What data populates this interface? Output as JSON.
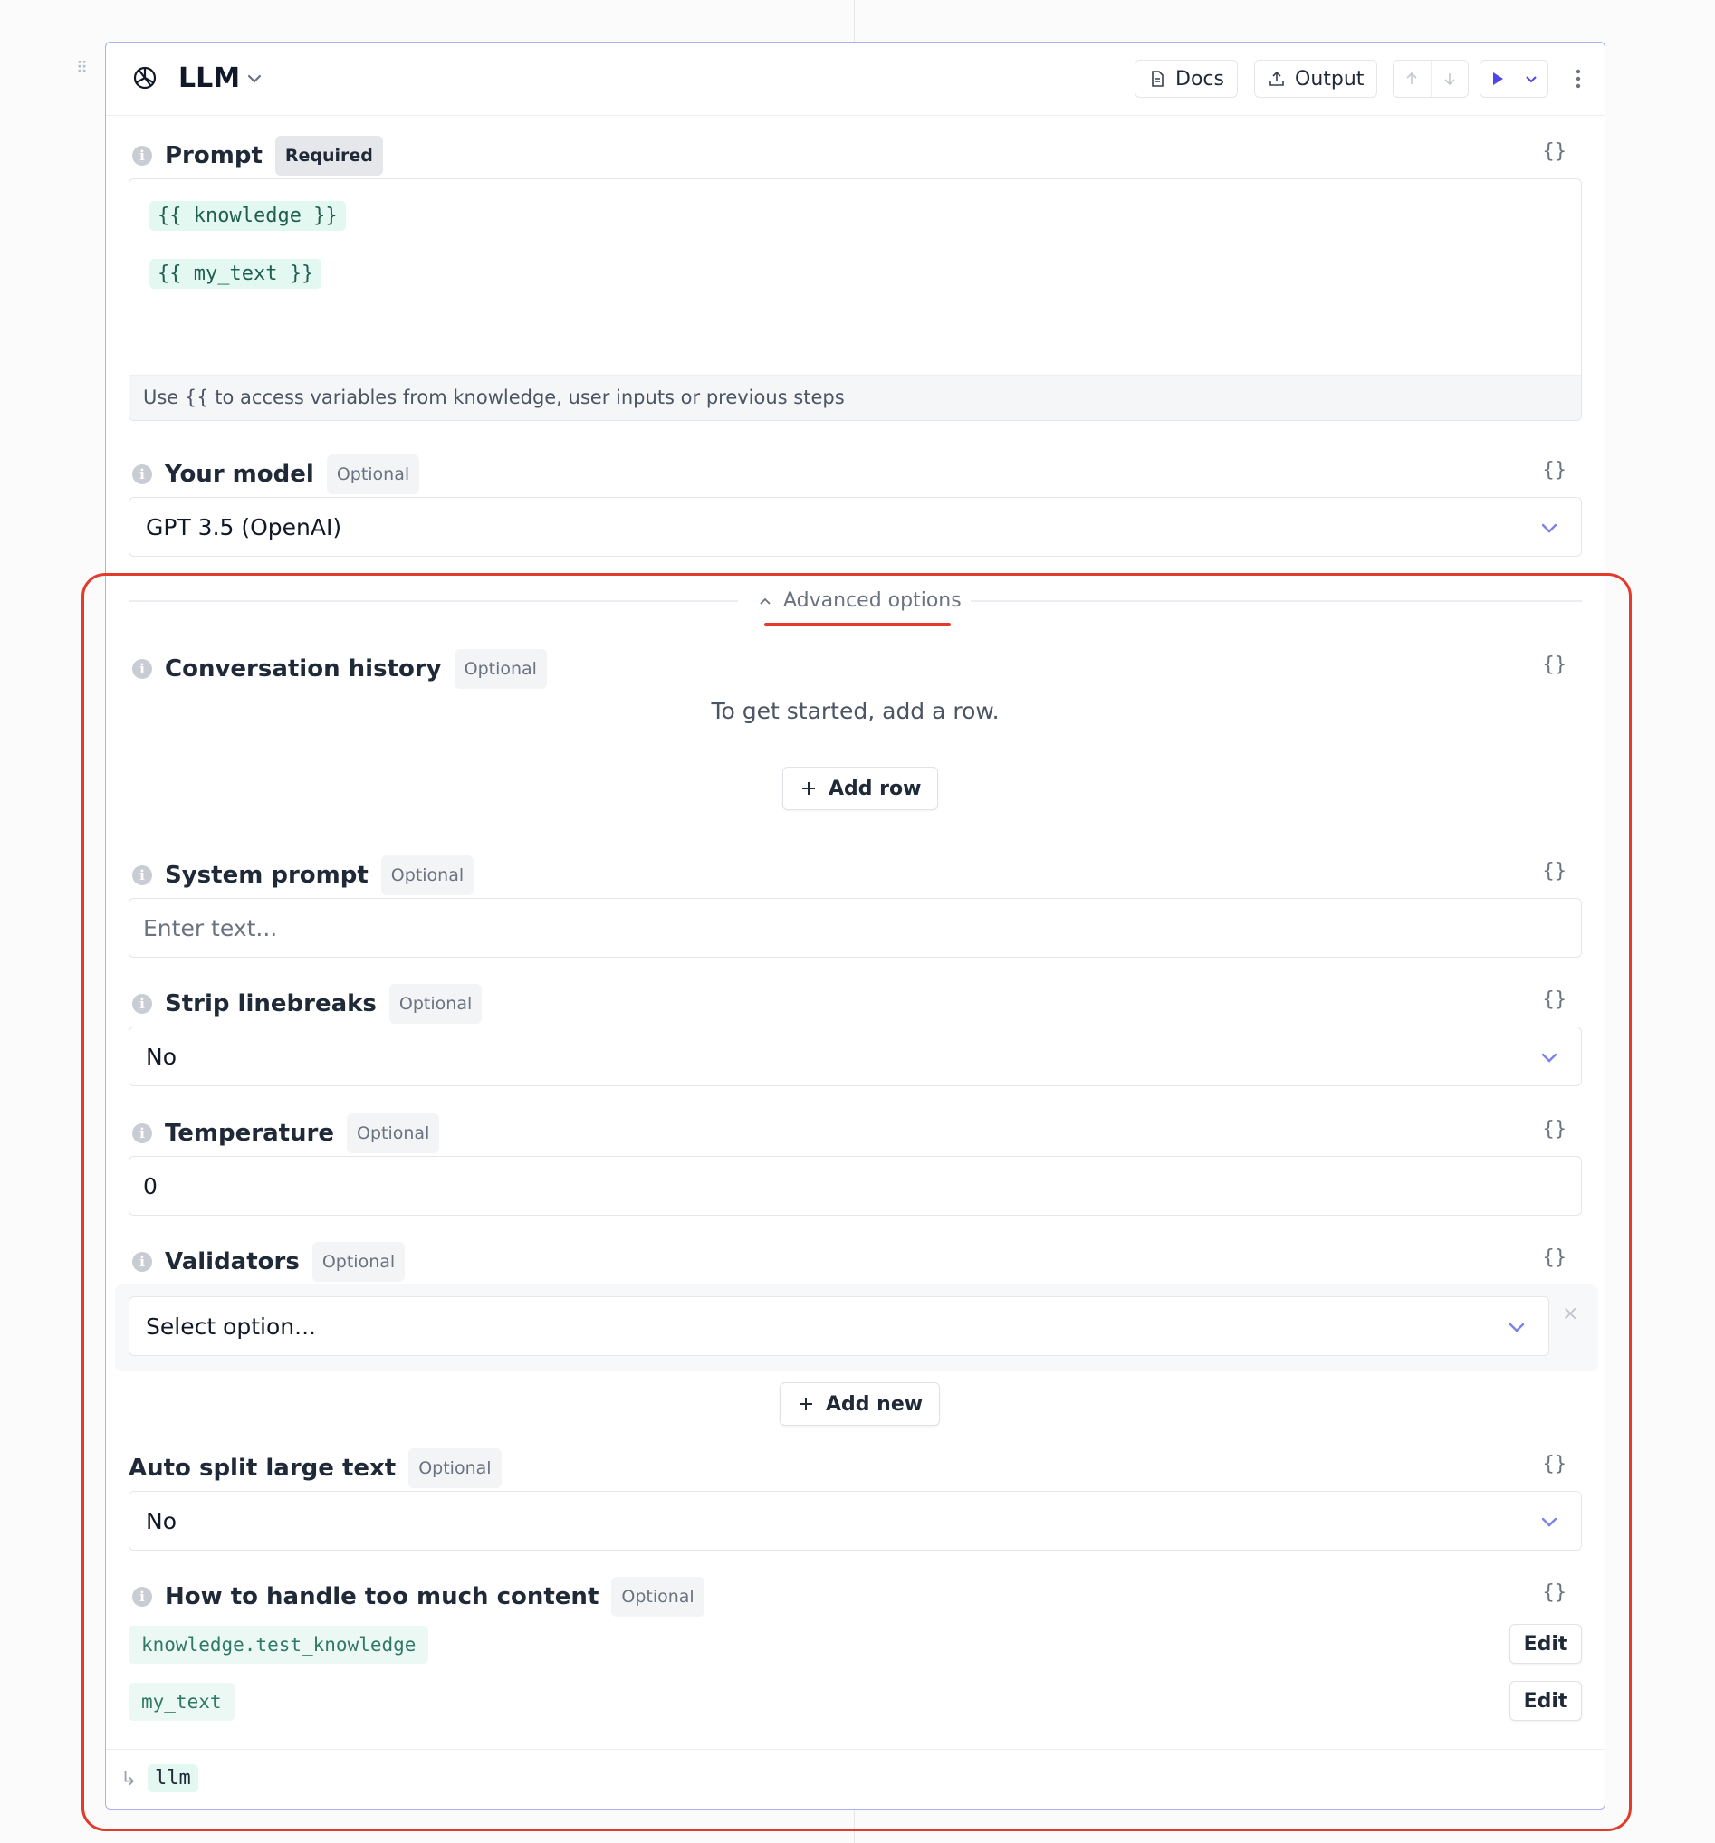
{
  "node": {
    "title": "LLM",
    "logo_icon": "openai-logo-icon",
    "header": {
      "docs_label": "Docs",
      "output_label": "Output"
    }
  },
  "prompt": {
    "label": "Prompt",
    "badge": "Required",
    "variables": [
      "{{ knowledge }}",
      "{{ my_text }}"
    ],
    "hint": "Use {{ to access variables from knowledge, user inputs or previous steps",
    "braces": "{}"
  },
  "model": {
    "label": "Your model",
    "badge": "Optional",
    "value": "GPT 3.5 (OpenAI)",
    "braces": "{}"
  },
  "advanced": {
    "label": "Advanced options"
  },
  "conversation_history": {
    "label": "Conversation history",
    "badge": "Optional",
    "empty_text": "To get started, add a row.",
    "add_row_label": "Add row",
    "braces": "{}"
  },
  "system_prompt": {
    "label": "System prompt",
    "badge": "Optional",
    "placeholder": "Enter text...",
    "braces": "{}"
  },
  "strip_linebreaks": {
    "label": "Strip linebreaks",
    "badge": "Optional",
    "value": "No",
    "braces": "{}"
  },
  "temperature": {
    "label": "Temperature",
    "badge": "Optional",
    "value": "0",
    "braces": "{}"
  },
  "validators": {
    "label": "Validators",
    "badge": "Optional",
    "select_placeholder": "Select option...",
    "clear_label": "×",
    "add_new_label": "Add new",
    "braces": "{}"
  },
  "auto_split": {
    "label": "Auto split large text",
    "badge": "Optional",
    "value": "No",
    "braces": "{}"
  },
  "too_much_content": {
    "label": "How to handle too much content",
    "badge": "Optional",
    "braces": "{}",
    "items": [
      {
        "name": "knowledge.test_knowledge",
        "edit_label": "Edit"
      },
      {
        "name": "my_text",
        "edit_label": "Edit"
      }
    ]
  },
  "footer": {
    "output_variable": "llm"
  },
  "colors": {
    "accent": "#4f46e5",
    "card_border": "#a9b0f3",
    "highlight": "#e23a2b",
    "variable_chip_bg": "#e4f8f2"
  }
}
